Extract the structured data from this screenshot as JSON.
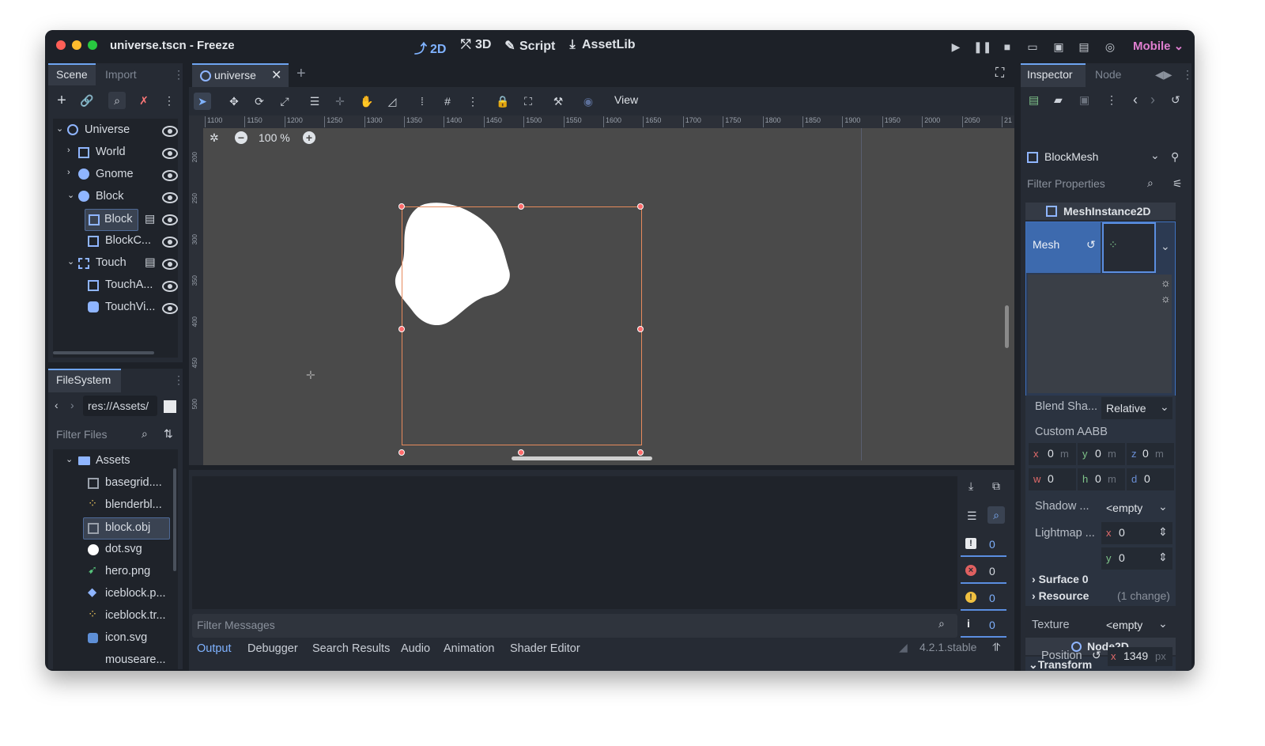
{
  "window": {
    "title": "universe.tscn - Freeze"
  },
  "topbar": {
    "modes": [
      "2D",
      "3D",
      "Script",
      "AssetLib"
    ],
    "active_mode": "2D",
    "renderer": "Mobile"
  },
  "scene_dock": {
    "tabs": [
      "Scene",
      "Import"
    ],
    "tree": [
      {
        "label": "Universe",
        "icon": "node2d-icon"
      },
      {
        "label": "World",
        "icon": "control-icon"
      },
      {
        "label": "Gnome",
        "icon": "globe-icon"
      },
      {
        "label": "Block",
        "icon": "globe-icon"
      },
      {
        "label": "Block",
        "icon": "mesh-icon"
      },
      {
        "label": "BlockC...",
        "icon": "shape-icon"
      },
      {
        "label": "Touch",
        "icon": "touch-icon"
      },
      {
        "label": "TouchA...",
        "icon": "shape-icon"
      },
      {
        "label": "TouchVi...",
        "icon": "visual-icon"
      }
    ]
  },
  "filesystem": {
    "tab": "FileSystem",
    "path": "res://Assets/",
    "filter_placeholder": "Filter Files",
    "items": [
      "Assets",
      "basegrid....",
      "blenderbl...",
      "block.obj",
      "dot.svg",
      "hero.png",
      "iceblock.p...",
      "iceblock.tr...",
      "icon.svg",
      "mouseare..."
    ]
  },
  "viewport": {
    "tab": "universe",
    "view_menu": "View",
    "zoom": "100 %",
    "ruler": [
      "1100",
      "1150",
      "1200",
      "1250",
      "1300",
      "1350",
      "1400",
      "1450",
      "1500",
      "1550",
      "1600",
      "1650",
      "1700",
      "1750",
      "1800",
      "1850",
      "1900",
      "1950",
      "2000",
      "2050",
      "21"
    ],
    "vruler": [
      "200",
      "250",
      "300",
      "350",
      "400",
      "450",
      "500"
    ]
  },
  "bottom": {
    "filter_placeholder": "Filter Messages",
    "counts": [
      "0",
      "0",
      "0",
      "0"
    ],
    "tabs": [
      "Output",
      "Debugger",
      "Search Results",
      "Audio",
      "Animation",
      "Shader Editor"
    ],
    "active_tab": "Output",
    "version": "4.2.1.stable"
  },
  "inspector": {
    "tabs": [
      "Inspector",
      "Node"
    ],
    "resource": "BlockMesh",
    "filter_placeholder": "Filter Properties",
    "class_header": "MeshInstance2D",
    "mesh_label": "Mesh",
    "blend_label": "Blend Sha...",
    "blend_value": "Relative",
    "aabb_label": "Custom AABB",
    "aabb": {
      "x": "0",
      "y": "0",
      "z": "0",
      "w": "0",
      "h": "0",
      "d": "0",
      "unit": "m"
    },
    "shadow_label": "Shadow ...",
    "shadow_value": "<empty",
    "lightmap_label": "Lightmap ...",
    "lightmap_x": "0",
    "lightmap_y": "0",
    "surface": "Surface 0",
    "resource_label": "Resource",
    "resource_change": "(1 change)",
    "texture_label": "Texture",
    "texture_value": "<empty",
    "node2d_header": "Node2D",
    "transform": "Transform",
    "position_label": "Position",
    "position_x": "1349",
    "position_unit": "px"
  }
}
